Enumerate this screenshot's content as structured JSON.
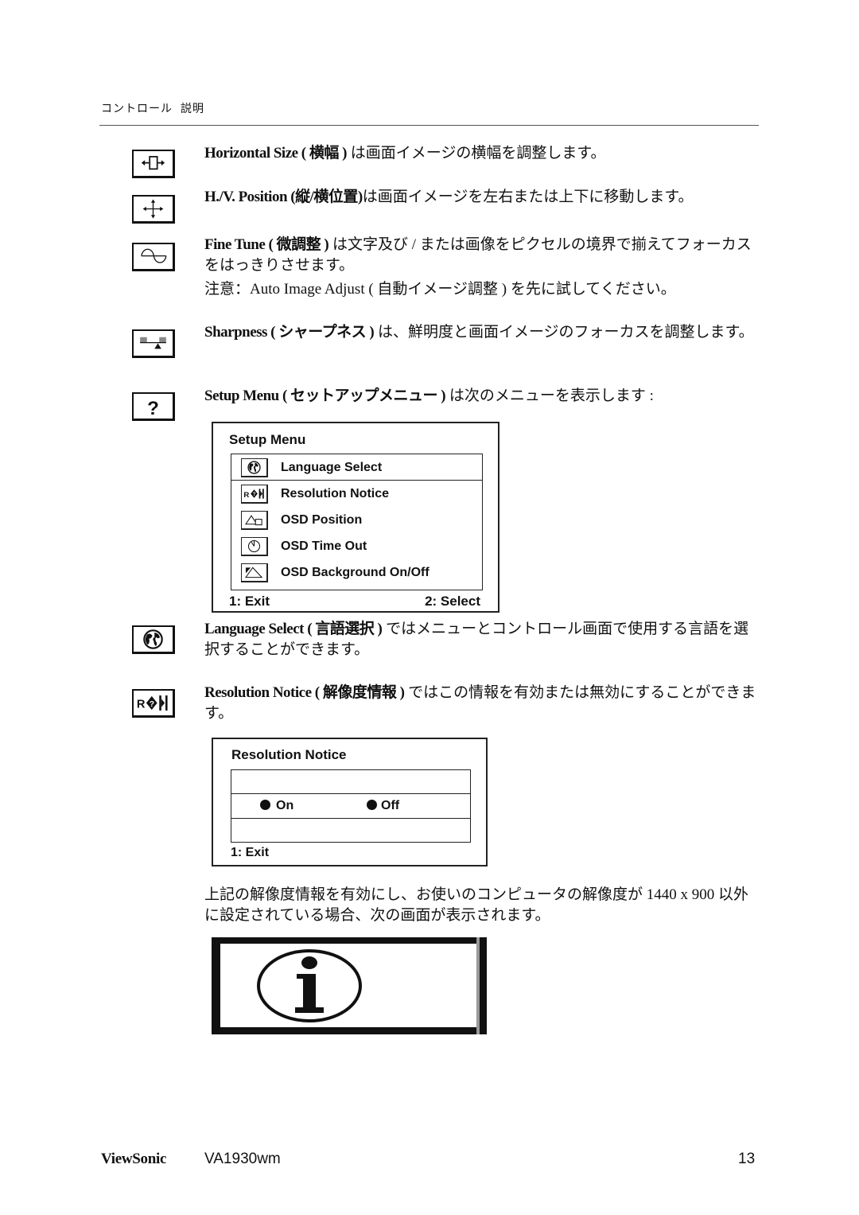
{
  "header": {
    "col1": "コントロール",
    "col2": "説明"
  },
  "items": [
    {
      "icon": "horizontal-size-icon",
      "bold": "Horizontal Size ( 横幅 )",
      "text": " は画面イメージの横幅を調整します。"
    },
    {
      "icon": "hv-position-icon",
      "bold": "H./V. Position (縦/横位置)",
      "text": "は画面イメージを左右または上下に移動します。"
    },
    {
      "icon": "fine-tune-icon",
      "bold": "Fine Tune ( 微調整 )",
      "text": " は文字及び / または画像をピクセルの境界で揃えてフォーカスをはっきりさせます。",
      "note": "注意：Auto Image Adjust ( 自動イメージ調整 ) を先に試してください。"
    },
    {
      "icon": "sharpness-icon",
      "bold": "Sharpness ( シャープネス )",
      "text": " は、鮮明度と画面イメージのフォーカスを調整します。"
    },
    {
      "icon": "setup-menu-icon",
      "bold": "Setup Menu ( セットアップメニュー )",
      "text": " は次のメニューを表示します :"
    },
    {
      "icon": "language-select-icon",
      "bold": "Language Select ( 言語選択 )",
      "text": " ではメニューとコントロール画面で使用する言語を選択することができます。"
    },
    {
      "icon": "resolution-notice-icon",
      "bold": "Resolution Notice ( 解像度情報 )",
      "text": " ではこの情報を有効または無効にすることができます。"
    }
  ],
  "setup_menu": {
    "title": "Setup Menu",
    "items": [
      {
        "icon": "globe-icon",
        "label": "Language Select"
      },
      {
        "icon": "resolution-notice-icon",
        "label": "Resolution Notice"
      },
      {
        "icon": "osd-position-icon",
        "label": "OSD Position"
      },
      {
        "icon": "clock-icon",
        "label": "OSD Time Out"
      },
      {
        "icon": "osd-background-icon",
        "label": "OSD Background On/Off"
      }
    ],
    "exit": "1: Exit",
    "select": "2: Select"
  },
  "resolution_notice": {
    "title": "Resolution Notice",
    "on": "On",
    "off": "Off",
    "exit": "1: Exit"
  },
  "resolution_paragraph": "上記の解像度情報を有効にし、お使いのコンピュータの解像度が 1440 x 900 以外に設定されている場合、次の画面が表示されます。",
  "info_icon": "info-icon",
  "footer": {
    "brand": "ViewSonic",
    "model": "VA1930wm",
    "page": "13"
  }
}
